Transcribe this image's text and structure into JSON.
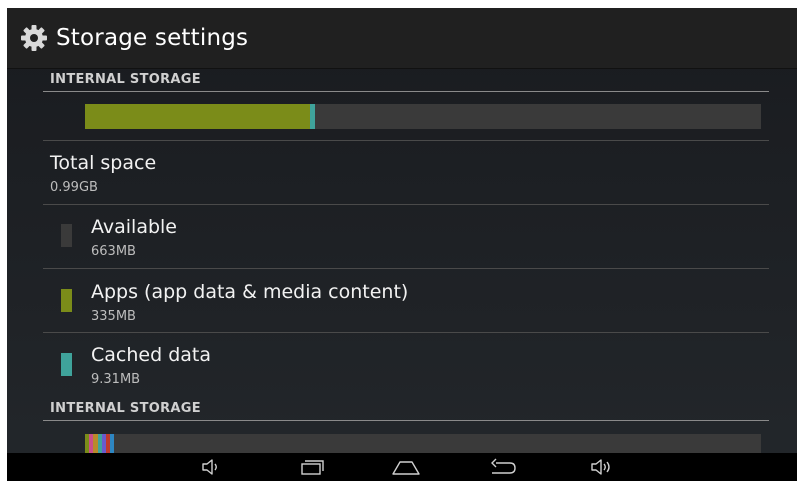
{
  "header": {
    "title": "Storage settings",
    "icon": "gear-icon"
  },
  "sections": [
    {
      "label": "INTERNAL STORAGE",
      "usage_fractions": {
        "apps": 0.335,
        "cached": 0.009,
        "available": 0.656
      }
    },
    {
      "label": "INTERNAL STORAGE"
    }
  ],
  "total": {
    "title": "Total space",
    "value": "0.99GB"
  },
  "items": [
    {
      "title": "Available",
      "value": "663MB",
      "color": "#3a3a3a"
    },
    {
      "title": "Apps (app data & media content)",
      "value": "335MB",
      "color": "#7b8c19"
    },
    {
      "title": "Cached data",
      "value": "9.31MB",
      "color": "#3fa39b"
    }
  ],
  "colors": {
    "apps": "#7b8c19",
    "cached": "#3fa39b",
    "available": "#3a3a3a",
    "header_bg": "#202020"
  },
  "nav": [
    "volume-down-icon",
    "recent-apps-icon",
    "home-icon",
    "back-icon",
    "volume-up-icon"
  ]
}
